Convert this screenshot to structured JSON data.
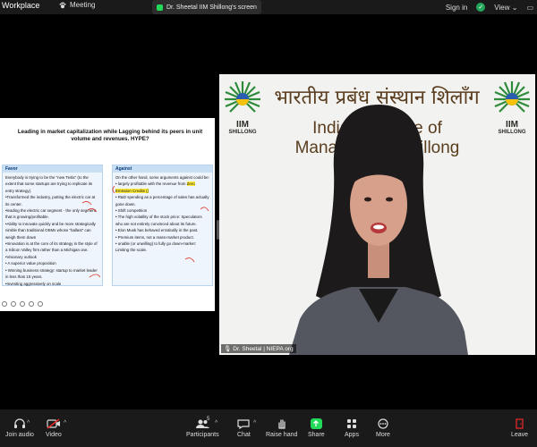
{
  "topbar": {
    "app_name": "Workplace",
    "meeting_label": "Meeting",
    "share_label": "Dr. Sheetal IIM Shillong's screen",
    "sign_in": "Sign in",
    "view_label": "View"
  },
  "slide": {
    "title": "Leading in market capitalization while Lagging behind its peers in unit volume and revenues. HYPE?",
    "favor": {
      "header": "Favor",
      "items": [
        "Everybody is trying to be the \"new Tesla\" (to the extent that some startups are trying to replicate its entry strategy).",
        "•Transformed the industry, putting the electric car at its center.",
        "•leading the electric car segment - the only segment that is growing/profitable.",
        "•Ability to innovate quickly and be more strategically nimble than traditional OEMs whose \"ballast\" can weigh them down",
        "•Innovation is at the core of its strategy in the style of a Silicon Valley firm rather than a Michigan one.",
        "•Visionary outlook",
        "• A superior value proposition",
        "• Winning business strategy: startup to market leader in less than 15 years.",
        "•Investing aggressively on scale"
      ]
    },
    "against": {
      "header": "Against",
      "intro": "On the other hand, some arguments against could be:",
      "item1_pre": "• largely profitable with the revenue from ",
      "item1_highlight": "Zero Emission Credits ()",
      "items": [
        "• R&D spending as a percentage of sales has actually gone down.",
        "• Shift competition",
        "• The high volatility of the stock price: Speculators who are not entirely convinced about its future.",
        "• Elon Musk has behaved erratically in the past.",
        "• Premium items, not a mass-market product.",
        "• unable (or unwilling) to fully go down-market: Limiting the scale."
      ]
    }
  },
  "video": {
    "banner_hindi": "भारतीय प्रबंध संस्थान शिलाँग",
    "banner_english": "Indian Institute of Management Shillong",
    "logo_text": "IIM",
    "logo_sub": "SHILLONG",
    "participant_name": "Dr. Sheetal | NIEPA org"
  },
  "toolbar": {
    "audio": "Join audio",
    "video": "Video",
    "participants": "Participants",
    "participants_count": "5",
    "chat": "Chat",
    "raise_hand": "Raise hand",
    "share": "Share",
    "apps": "Apps",
    "more": "More",
    "leave": "Leave"
  },
  "colors": {
    "share_green": "#23d959",
    "leave_red": "#e02828",
    "slide_header_bg": "#c9dff4",
    "highlight": "#ffeb3b",
    "banner_text": "#5a3d1e"
  }
}
